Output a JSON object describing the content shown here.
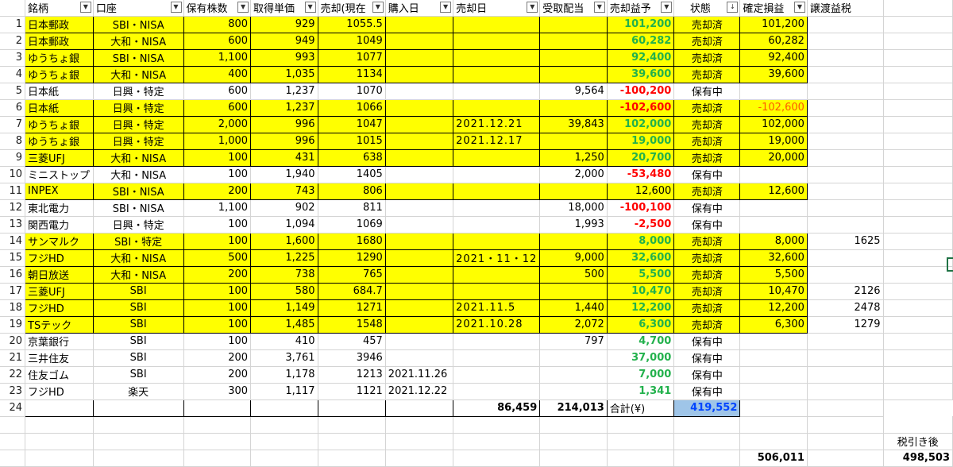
{
  "headers": [
    "銘柄",
    "口座",
    "保有株数",
    "取得単価",
    "売却(現在",
    "購入日",
    "売却日",
    "受取配当",
    "売却益予",
    "状態",
    "確定損益",
    "譲渡益税"
  ],
  "header_sort_icon": "↓",
  "rows": [
    {
      "n": "1",
      "name": "日本郵政",
      "acct": "SBI・NISA",
      "qty": "800",
      "cost": "929",
      "sell": "1055.5",
      "buy": "",
      "sold": "",
      "div": "",
      "gain": "101,200",
      "gc": "g",
      "status": "売却済",
      "pl": "101,200",
      "plc": "",
      "tax": "",
      "hl": true
    },
    {
      "n": "2",
      "name": "日本郵政",
      "acct": "大和・NISA",
      "qty": "600",
      "cost": "949",
      "sell": "1049",
      "buy": "",
      "sold": "",
      "div": "",
      "gain": "60,282",
      "gc": "g",
      "status": "売却済",
      "pl": "60,282",
      "plc": "",
      "tax": "",
      "hl": true
    },
    {
      "n": "3",
      "name": "ゆうちょ銀",
      "acct": "SBI・NISA",
      "qty": "1,100",
      "cost": "993",
      "sell": "1077",
      "buy": "",
      "sold": "",
      "div": "",
      "gain": "92,400",
      "gc": "g",
      "status": "売却済",
      "pl": "92,400",
      "plc": "",
      "tax": "",
      "hl": true
    },
    {
      "n": "4",
      "name": "ゆうちょ銀",
      "acct": "大和・NISA",
      "qty": "400",
      "cost": "1,035",
      "sell": "1134",
      "buy": "",
      "sold": "",
      "div": "",
      "gain": "39,600",
      "gc": "g",
      "status": "売却済",
      "pl": "39,600",
      "plc": "",
      "tax": "",
      "hl": true
    },
    {
      "n": "5",
      "name": "日本紙",
      "acct": "日興・特定",
      "qty": "600",
      "cost": "1,237",
      "sell": "1070",
      "buy": "",
      "sold": "",
      "div": "9,564",
      "gain": "-100,200",
      "gc": "red",
      "status": "保有中",
      "pl": "",
      "plc": "",
      "tax": "",
      "hl": false
    },
    {
      "n": "6",
      "name": "日本紙",
      "acct": "日興・特定",
      "qty": "600",
      "cost": "1,237",
      "sell": "1066",
      "buy": "",
      "sold": "",
      "div": "",
      "gain": "-102,600",
      "gc": "red",
      "status": "売却済",
      "pl": "-102,600",
      "plc": "or",
      "tax": "",
      "hl": true
    },
    {
      "n": "7",
      "name": "ゆうちょ銀",
      "acct": "日興・特定",
      "qty": "2,000",
      "cost": "996",
      "sell": "1047",
      "buy": "",
      "sold": "2021.12.21",
      "div": "39,843",
      "gain": "102,000",
      "gc": "g",
      "status": "売却済",
      "pl": "102,000",
      "plc": "",
      "tax": "",
      "hl": true
    },
    {
      "n": "8",
      "name": "ゆうちょ銀",
      "acct": "日興・特定",
      "qty": "1,000",
      "cost": "996",
      "sell": "1015",
      "buy": "",
      "sold": "2021.12.17",
      "div": "",
      "gain": "19,000",
      "gc": "g",
      "status": "売却済",
      "pl": "19,000",
      "plc": "",
      "tax": "",
      "hl": true
    },
    {
      "n": "9",
      "name": "三菱UFJ",
      "acct": "大和・NISA",
      "qty": "100",
      "cost": "431",
      "sell": "638",
      "buy": "",
      "sold": "",
      "div": "1,250",
      "gain": "20,700",
      "gc": "g",
      "status": "売却済",
      "pl": "20,000",
      "plc": "",
      "tax": "",
      "hl": true
    },
    {
      "n": "10",
      "name": "ミニストップ",
      "acct": "大和・NISA",
      "qty": "100",
      "cost": "1,940",
      "sell": "1405",
      "buy": "",
      "sold": "",
      "div": "2,000",
      "gain": "-53,480",
      "gc": "red",
      "status": "保有中",
      "pl": "",
      "plc": "",
      "tax": "",
      "hl": false
    },
    {
      "n": "11",
      "name": "INPEX",
      "acct": "SBI・NISA",
      "qty": "200",
      "cost": "743",
      "sell": "806",
      "buy": "",
      "sold": "",
      "div": "",
      "gain": "12,600",
      "gc": "",
      "status": "売却済",
      "pl": "12,600",
      "plc": "",
      "tax": "",
      "hl": true
    },
    {
      "n": "12",
      "name": "東北電力",
      "acct": "SBI・NISA",
      "qty": "1,100",
      "cost": "902",
      "sell": "811",
      "buy": "",
      "sold": "",
      "div": "18,000",
      "gain": "-100,100",
      "gc": "red",
      "status": "保有中",
      "pl": "",
      "plc": "",
      "tax": "",
      "hl": false
    },
    {
      "n": "13",
      "name": "関西電力",
      "acct": "日興・特定",
      "qty": "100",
      "cost": "1,094",
      "sell": "1069",
      "buy": "",
      "sold": "",
      "div": "1,993",
      "gain": "-2,500",
      "gc": "red",
      "status": "保有中",
      "pl": "",
      "plc": "",
      "tax": "",
      "hl": false
    },
    {
      "n": "14",
      "name": "サンマルク",
      "acct": "SBI・特定",
      "qty": "100",
      "cost": "1,600",
      "sell": "1680",
      "buy": "",
      "sold": "",
      "div": "",
      "gain": "8,000",
      "gc": "g",
      "status": "売却済",
      "pl": "8,000",
      "plc": "",
      "tax": "1625",
      "hl": true
    },
    {
      "n": "15",
      "name": "フジHD",
      "acct": "大和・NISA",
      "qty": "500",
      "cost": "1,225",
      "sell": "1290",
      "buy": "",
      "sold": "2021・11・12",
      "div": "9,000",
      "gain": "32,600",
      "gc": "g",
      "status": "売却済",
      "pl": "32,600",
      "plc": "",
      "tax": "",
      "hl": true
    },
    {
      "n": "16",
      "name": "朝日放送",
      "acct": "大和・NISA",
      "qty": "200",
      "cost": "738",
      "sell": "765",
      "buy": "",
      "sold": "",
      "div": "500",
      "gain": "5,500",
      "gc": "g",
      "status": "売却済",
      "pl": "5,500",
      "plc": "",
      "tax": "",
      "hl": true
    },
    {
      "n": "17",
      "name": "三菱UFJ",
      "acct": "SBI",
      "qty": "100",
      "cost": "580",
      "sell": "684.7",
      "buy": "",
      "sold": "",
      "div": "",
      "gain": "10,470",
      "gc": "g",
      "status": "売却済",
      "pl": "10,470",
      "plc": "",
      "tax": "2126",
      "hl": true
    },
    {
      "n": "18",
      "name": "フジHD",
      "acct": "SBI",
      "qty": "100",
      "cost": "1,149",
      "sell": "1271",
      "buy": "",
      "sold": "2021.11.5",
      "div": "1,440",
      "gain": "12,200",
      "gc": "g",
      "status": "売却済",
      "pl": "12,200",
      "plc": "",
      "tax": "2478",
      "hl": true
    },
    {
      "n": "19",
      "name": "TSテック",
      "acct": "SBI",
      "qty": "100",
      "cost": "1,485",
      "sell": "1548",
      "buy": "",
      "sold": "2021.10.28",
      "div": "2,072",
      "gain": "6,300",
      "gc": "g",
      "status": "売却済",
      "pl": "6,300",
      "plc": "",
      "tax": "1279",
      "hl": true
    },
    {
      "n": "20",
      "name": "京葉銀行",
      "acct": "SBI",
      "qty": "100",
      "cost": "410",
      "sell": "457",
      "buy": "",
      "sold": "",
      "div": "797",
      "gain": "4,700",
      "gc": "g",
      "status": "保有中",
      "pl": "",
      "plc": "",
      "tax": "",
      "hl": false
    },
    {
      "n": "21",
      "name": "三井住友",
      "acct": "SBI",
      "qty": "200",
      "cost": "3,761",
      "sell": "3946",
      "buy": "",
      "sold": "",
      "div": "",
      "gain": "37,000",
      "gc": "g",
      "status": "保有中",
      "pl": "",
      "plc": "",
      "tax": "",
      "hl": false
    },
    {
      "n": "22",
      "name": "住友ゴム",
      "acct": "SBI",
      "qty": "200",
      "cost": "1,178",
      "sell": "1213",
      "buy": "2021.11.26",
      "sold": "",
      "div": "",
      "gain": "7,000",
      "gc": "g",
      "status": "保有中",
      "pl": "",
      "plc": "",
      "tax": "",
      "hl": false
    },
    {
      "n": "23",
      "name": "フジHD",
      "acct": "楽天",
      "qty": "300",
      "cost": "1,117",
      "sell": "1121",
      "buy": "2021.12.22",
      "sold": "",
      "div": "",
      "gain": "1,341",
      "gc": "g",
      "status": "保有中",
      "pl": "",
      "plc": "",
      "tax": "",
      "hl": false
    }
  ],
  "totals": {
    "row": "24",
    "dividends": "86,459",
    "gain": "214,013",
    "label": "合計(¥)",
    "confirmed": "419,552"
  },
  "footer": {
    "after_tax_label": "税引き後",
    "sum": "506,011",
    "after_tax": "498,503"
  }
}
